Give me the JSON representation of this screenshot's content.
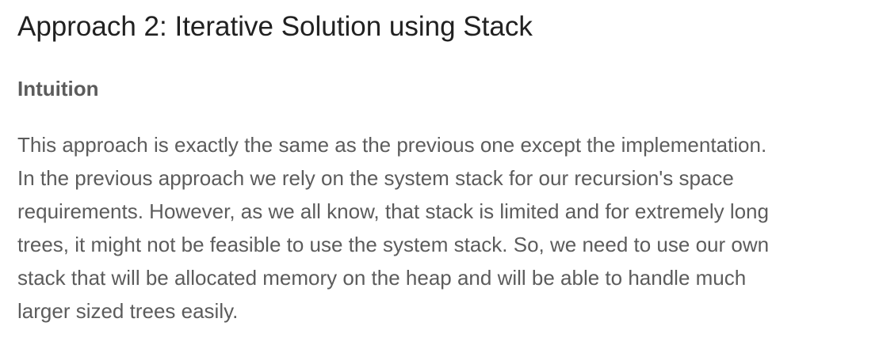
{
  "article": {
    "title": "Approach 2: Iterative Solution using Stack",
    "section_heading": "Intuition",
    "paragraph_lines": [
      "This approach is exactly the same as the previous one except the implementation.",
      "In the previous approach we rely on the system stack for our recursion's space",
      "requirements. However, as we all know, that stack is limited and for extremely long",
      "trees, it might not be feasible to use the system stack. So, we need to use our own",
      "stack that will be allocated memory on the heap and will be able to handle much",
      "larger sized trees easily."
    ]
  },
  "colors": {
    "title_text": "#212121",
    "body_text": "#5c5c5c",
    "background": "#ffffff"
  }
}
